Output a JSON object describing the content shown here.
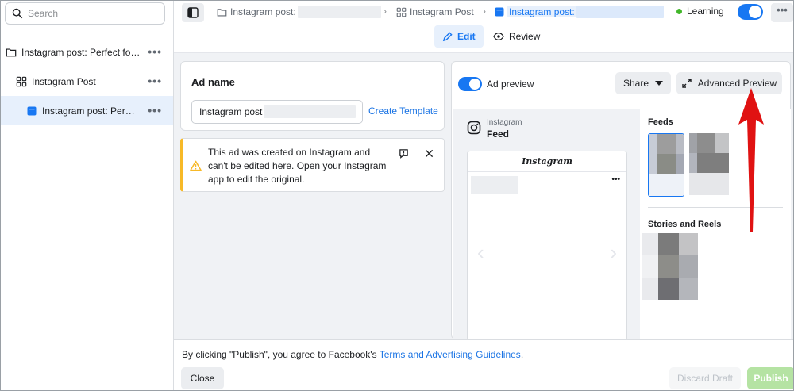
{
  "sidebar": {
    "search_placeholder": "Search",
    "items": [
      {
        "label": "Instagram post: Perfect for ..."
      },
      {
        "label": "Instagram Post"
      },
      {
        "label": "Instagram post: Perfe..."
      }
    ]
  },
  "header": {
    "breadcrumbs": [
      "Instagram post:",
      "Instagram Post",
      "Instagram post:"
    ],
    "status": "Learning",
    "tabs": {
      "edit": "Edit",
      "review": "Review"
    }
  },
  "ad_name": {
    "title": "Ad name",
    "value": "Instagram post",
    "create_template": "Create Template"
  },
  "warning": {
    "text": "This ad was created on Instagram and can't be edited here. Open your Instagram app to edit the original."
  },
  "preview": {
    "toggle_label": "Ad preview",
    "share_label": "Share",
    "advanced_label": "Advanced Preview",
    "platform": "Instagram",
    "placement": "Feed",
    "phone_brand": "Instagram",
    "feeds_title": "Feeds",
    "stories_title": "Stories and Reels"
  },
  "footer": {
    "note_prefix": "By clicking \"Publish\", you agree to Facebook's ",
    "note_link": "Terms and Advertising Guidelines",
    "note_suffix": ".",
    "close_label": "Close",
    "discard_label": "Discard Draft",
    "publish_label": "Publish"
  },
  "colors": {
    "accent": "#1877f2",
    "warning": "#f7b928",
    "publish": "#b5e3a3",
    "annotation_arrow": "#e01212"
  },
  "icons": [
    "search-icon",
    "folder-icon",
    "grid-icon",
    "ad-icon",
    "more-icon",
    "panel-icon",
    "pencil-icon",
    "eye-icon",
    "warning-icon",
    "feedback-icon",
    "close-icon",
    "chevron-down-icon",
    "expand-icon",
    "instagram-icon",
    "chevron-left-icon",
    "chevron-right-icon"
  ]
}
